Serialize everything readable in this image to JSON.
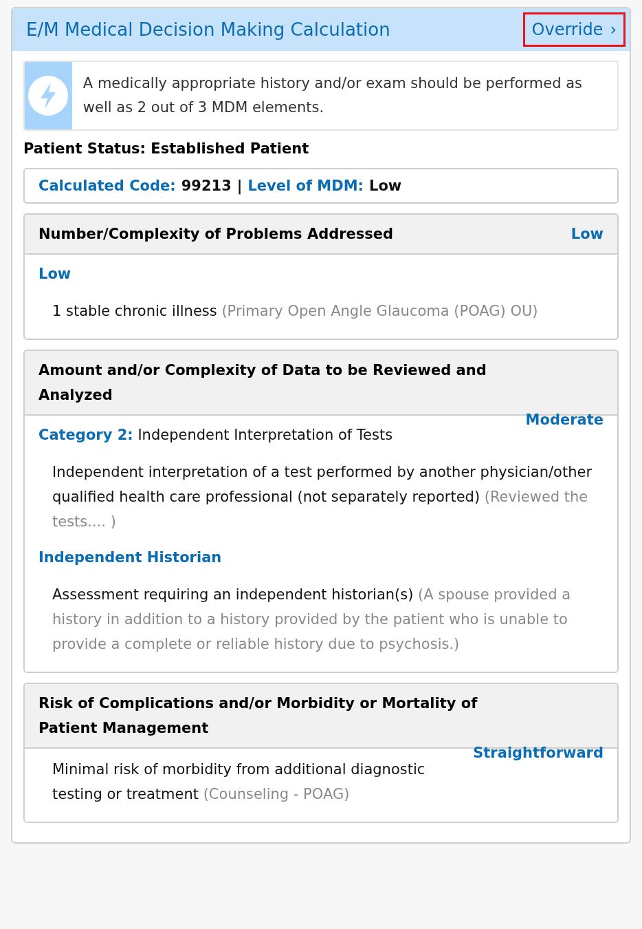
{
  "panel": {
    "title": "E/M Medical Decision Making Calculation",
    "override": {
      "label": "Override",
      "chevron": "›",
      "highlighted": true
    }
  },
  "notice": {
    "text": "A medically appropriate history and/or exam should be performed as well as 2 out of 3 MDM elements."
  },
  "patient_status": "Patient Status: Established Patient",
  "summary": {
    "code_label": "Calculated Code:",
    "code": "99213",
    "separator": "|",
    "level_label": "Level of MDM:",
    "level": "Low"
  },
  "sections": [
    {
      "title": "Number/Complexity of Problems Addressed",
      "level": "Low",
      "kind": "headed",
      "items": [
        {
          "kind": "heading",
          "label": "Low"
        },
        {
          "kind": "finding",
          "text": "1 stable chronic illness",
          "note": "(Primary Open Angle Glaucoma (POAG) OU)"
        }
      ]
    },
    {
      "title": "Amount and/or Complexity of Data to be Reviewed and Analyzed",
      "level": "Moderate",
      "kind": "floating",
      "items": [
        {
          "kind": "heading",
          "label": "Category 2:",
          "text": "Independent Interpretation of Tests"
        },
        {
          "kind": "finding",
          "text": "Independent interpretation of a test performed by another physician/other qualified health care professional (not separately reported)",
          "note": "(Reviewed the tests.... )"
        },
        {
          "kind": "heading",
          "label": "Independent Historian"
        },
        {
          "kind": "finding",
          "text": "Assessment requiring an independent historian(s)",
          "note": "(A spouse provided a history in addition to a history provided by the patient who is unable to provide a complete or reliable history due to psychosis.)"
        }
      ]
    },
    {
      "title": "Risk of Complications and/or Morbidity or Mortality of Patient Management",
      "level": "Straightforward",
      "kind": "floating",
      "items": [
        {
          "kind": "finding",
          "text": "Minimal risk of morbidity from additional diagnostic testing or treatment",
          "note": "(Counseling - POAG)"
        }
      ]
    }
  ]
}
